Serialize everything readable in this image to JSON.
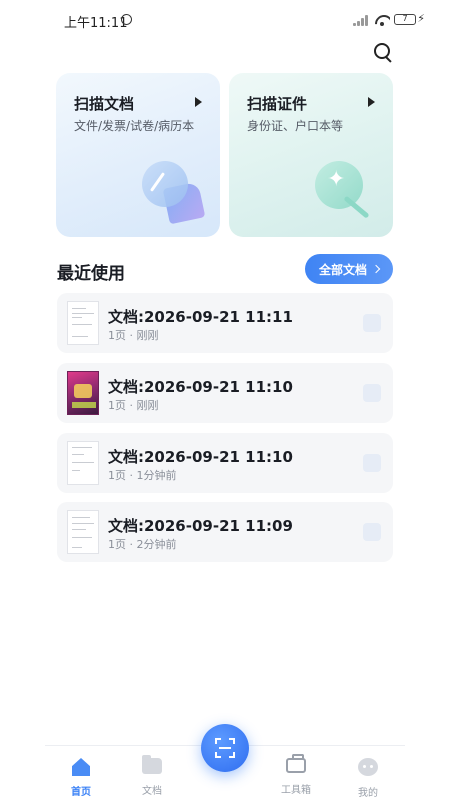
{
  "status_bar": {
    "time": "上午11:11",
    "battery": "7"
  },
  "scan_cards": [
    {
      "title": "扫描文档",
      "subtitle": "文件/发票/试卷/病历本"
    },
    {
      "title": "扫描证件",
      "subtitle": "身份证、户口本等"
    }
  ],
  "recent": {
    "title": "最近使用",
    "all_button": "全部文档",
    "items": [
      {
        "name": "文档:2026-09-21 11:11",
        "meta": "1页 · 刚刚"
      },
      {
        "name": "文档:2026-09-21 11:10",
        "meta": "1页 · 刚刚"
      },
      {
        "name": "文档:2026-09-21 11:10",
        "meta": "1页 · 1分钟前"
      },
      {
        "name": "文档:2026-09-21 11:09",
        "meta": "1页 · 2分钟前"
      }
    ]
  },
  "nav": {
    "items": [
      {
        "label": "首页",
        "icon": "home-icon",
        "active": true
      },
      {
        "label": "文档",
        "icon": "folder-icon",
        "active": false
      },
      {
        "label": "工具箱",
        "icon": "toolbox-icon",
        "active": false
      },
      {
        "label": "我的",
        "icon": "profile-icon",
        "active": false
      }
    ]
  },
  "colors": {
    "accent": "#3b82f6"
  }
}
